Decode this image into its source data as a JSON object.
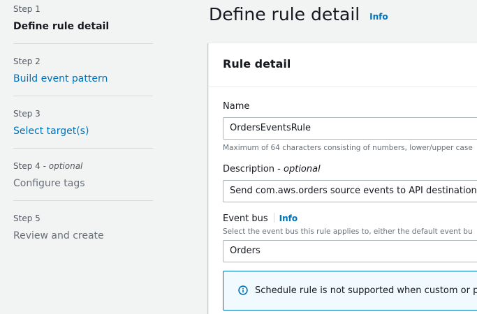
{
  "steps": [
    {
      "number": "Step 1",
      "optional": "",
      "title": "Define rule detail"
    },
    {
      "number": "Step 2",
      "optional": "",
      "title": "Build event pattern"
    },
    {
      "number": "Step 3",
      "optional": "",
      "title": "Select target(s)"
    },
    {
      "number": "Step 4",
      "optional": "optional",
      "title": "Configure tags"
    },
    {
      "number": "Step 5",
      "optional": "",
      "title": "Review and create"
    }
  ],
  "page": {
    "title": "Define rule detail",
    "info_label": "Info"
  },
  "panel": {
    "title": "Rule detail",
    "name": {
      "label": "Name",
      "value": "OrdersEventsRule",
      "hint": "Maximum of 64 characters consisting of numbers, lower/upper case"
    },
    "description": {
      "label": "Description",
      "optional": "optional",
      "value": "Send com.aws.orders source events to API destination"
    },
    "event_bus": {
      "label": "Event bus",
      "info_label": "Info",
      "hint": "Select the event bus this rule applies to, either the default event bu",
      "value": "Orders"
    },
    "alert": {
      "text": "Schedule rule is not supported when custom or pa",
      "icon": "info-circle-icon"
    }
  },
  "colors": {
    "link": "#0073bb",
    "background": "#f2f3f3",
    "info_alert_bg": "#f1faff",
    "info_alert_border": "#0073bb"
  }
}
